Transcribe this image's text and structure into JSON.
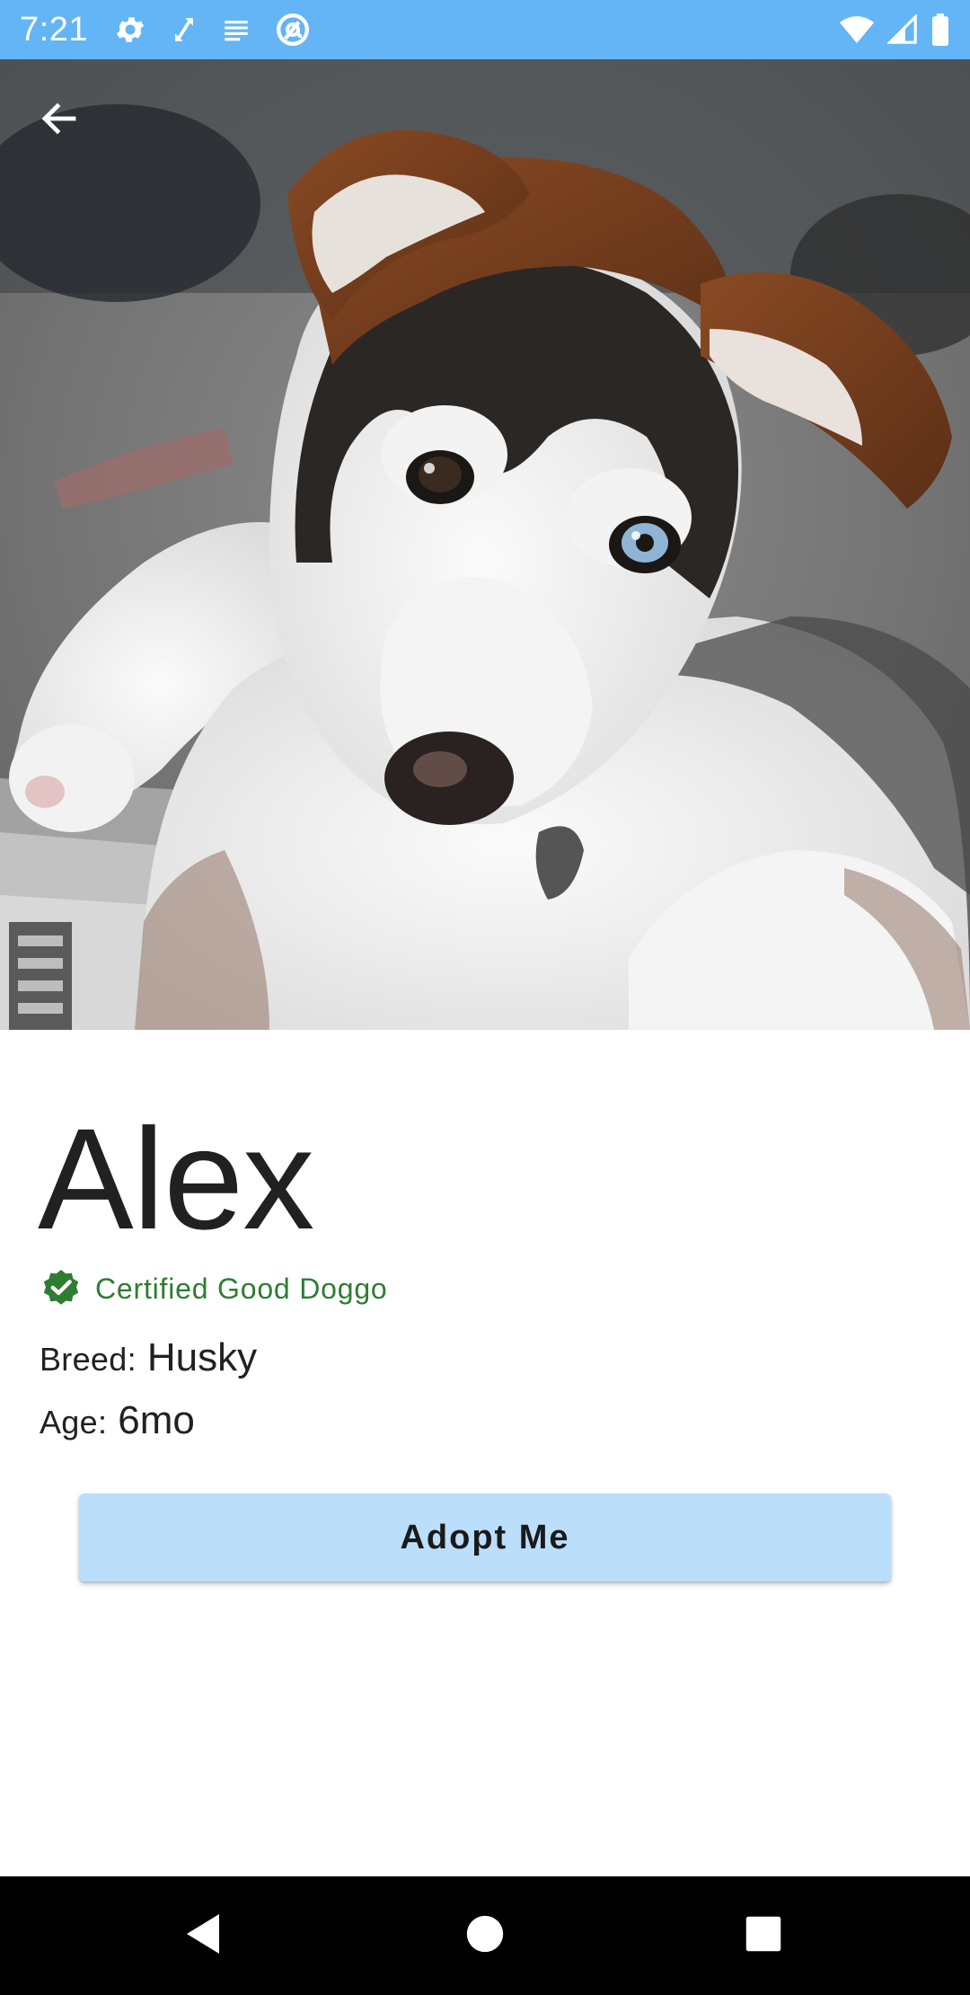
{
  "status_bar": {
    "time": "7:21",
    "left_icons": [
      "gear-icon",
      "expand-icon",
      "notes-icon",
      "at-sign-icon"
    ],
    "right_icons": [
      "wifi-icon",
      "signal-icon",
      "battery-icon"
    ],
    "background": "#64b5f6"
  },
  "toolbar": {
    "back_icon": "arrow-left-icon"
  },
  "pet": {
    "photo": "husky-puppy-photo",
    "name": "Alex",
    "certification": "Certified Good Doggo",
    "certification_color": "#2e7d32",
    "breed_label": "Breed:",
    "breed": "Husky",
    "age_label": "Age:",
    "age": "6mo"
  },
  "actions": {
    "adopt_label": "Adopt Me",
    "adopt_color": "#bbdefb"
  },
  "nav_bar": {
    "icons": [
      "nav-back-icon",
      "nav-home-icon",
      "nav-recents-icon"
    ]
  }
}
